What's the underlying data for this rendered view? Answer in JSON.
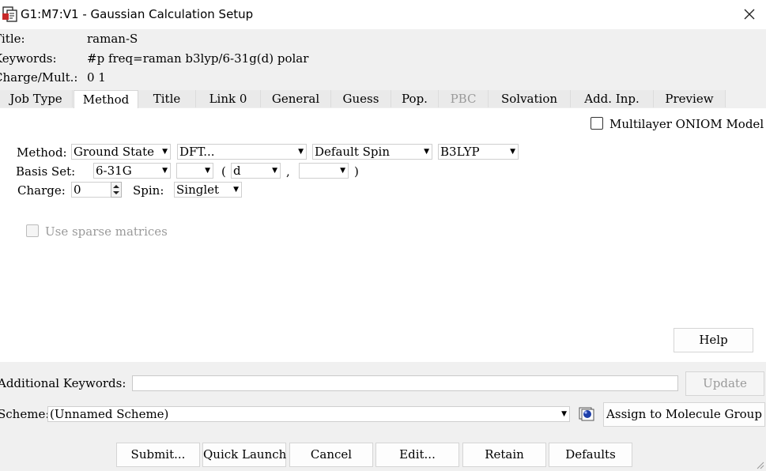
{
  "window": {
    "title": "G1:M7:V1 - Gaussian Calculation Setup"
  },
  "info": {
    "title_label": "Title:",
    "title_value": "raman-S",
    "keywords_label": "Keywords:",
    "keywords_value": "#p freq=raman b3lyp/6-31g(d) polar",
    "charge_label": "Charge/Mult.:",
    "charge_value": "0 1"
  },
  "tabs": [
    {
      "label": "Job Type"
    },
    {
      "label": "Method"
    },
    {
      "label": "Title"
    },
    {
      "label": "Link 0"
    },
    {
      "label": "General"
    },
    {
      "label": "Guess"
    },
    {
      "label": "Pop."
    },
    {
      "label": "PBC"
    },
    {
      "label": "Solvation"
    },
    {
      "label": "Add. Inp."
    },
    {
      "label": "Preview"
    }
  ],
  "method": {
    "multilayer_label": "Multilayer ONIOM Model",
    "method_label": "Method:",
    "state": "Ground State",
    "type": "DFT...",
    "spin_type": "Default Spin",
    "functional": "B3LYP",
    "basis_label": "Basis  Set:",
    "basis": "6-31G",
    "basis_ext": "",
    "paren_open": "(",
    "polarization": "d",
    "comma": ",",
    "diffuse": "",
    "paren_close": ")",
    "charge_label": "Charge:",
    "charge": "0",
    "spin_label": "Spin:",
    "spin": "Singlet",
    "sparse_label": "Use sparse matrices"
  },
  "help_label": "Help",
  "additional": {
    "label": "Additional Keywords:",
    "value": "",
    "update_label": "Update"
  },
  "scheme": {
    "label": "Scheme:",
    "value": "(Unnamed Scheme)",
    "assign_label": "Assign to Molecule Group"
  },
  "buttons": {
    "submit": "Submit...",
    "quick_launch": "Quick Launch",
    "cancel": "Cancel",
    "edit": "Edit...",
    "retain": "Retain",
    "defaults": "Defaults"
  },
  "colors": {
    "window_bg": "#f0f0f0",
    "panel_bg": "#ffffff",
    "disabled": "#9a9a9a"
  }
}
